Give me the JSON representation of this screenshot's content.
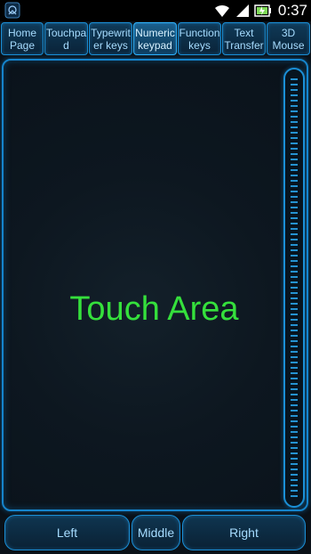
{
  "statusbar": {
    "time": "0:37",
    "icons": [
      "app-notification-icon",
      "wifi-icon",
      "signal-icon",
      "battery-charging-icon"
    ]
  },
  "tabs": [
    {
      "label": "Home\nPage"
    },
    {
      "label": "Touchpa\nd"
    },
    {
      "label": "Typewrit\ner keys"
    },
    {
      "label": "Numeric\nkeypad",
      "active": true
    },
    {
      "label": "Function\nkeys"
    },
    {
      "label": "Text\nTransfer"
    },
    {
      "label": "3D\nMouse"
    }
  ],
  "touch_area": {
    "label": "Touch Area"
  },
  "mouse_buttons": {
    "left": "Left",
    "middle": "Middle",
    "right": "Right"
  },
  "colors": {
    "accent": "#1a8fd6",
    "touch_text": "#35e03c",
    "background": "#0a1118"
  }
}
